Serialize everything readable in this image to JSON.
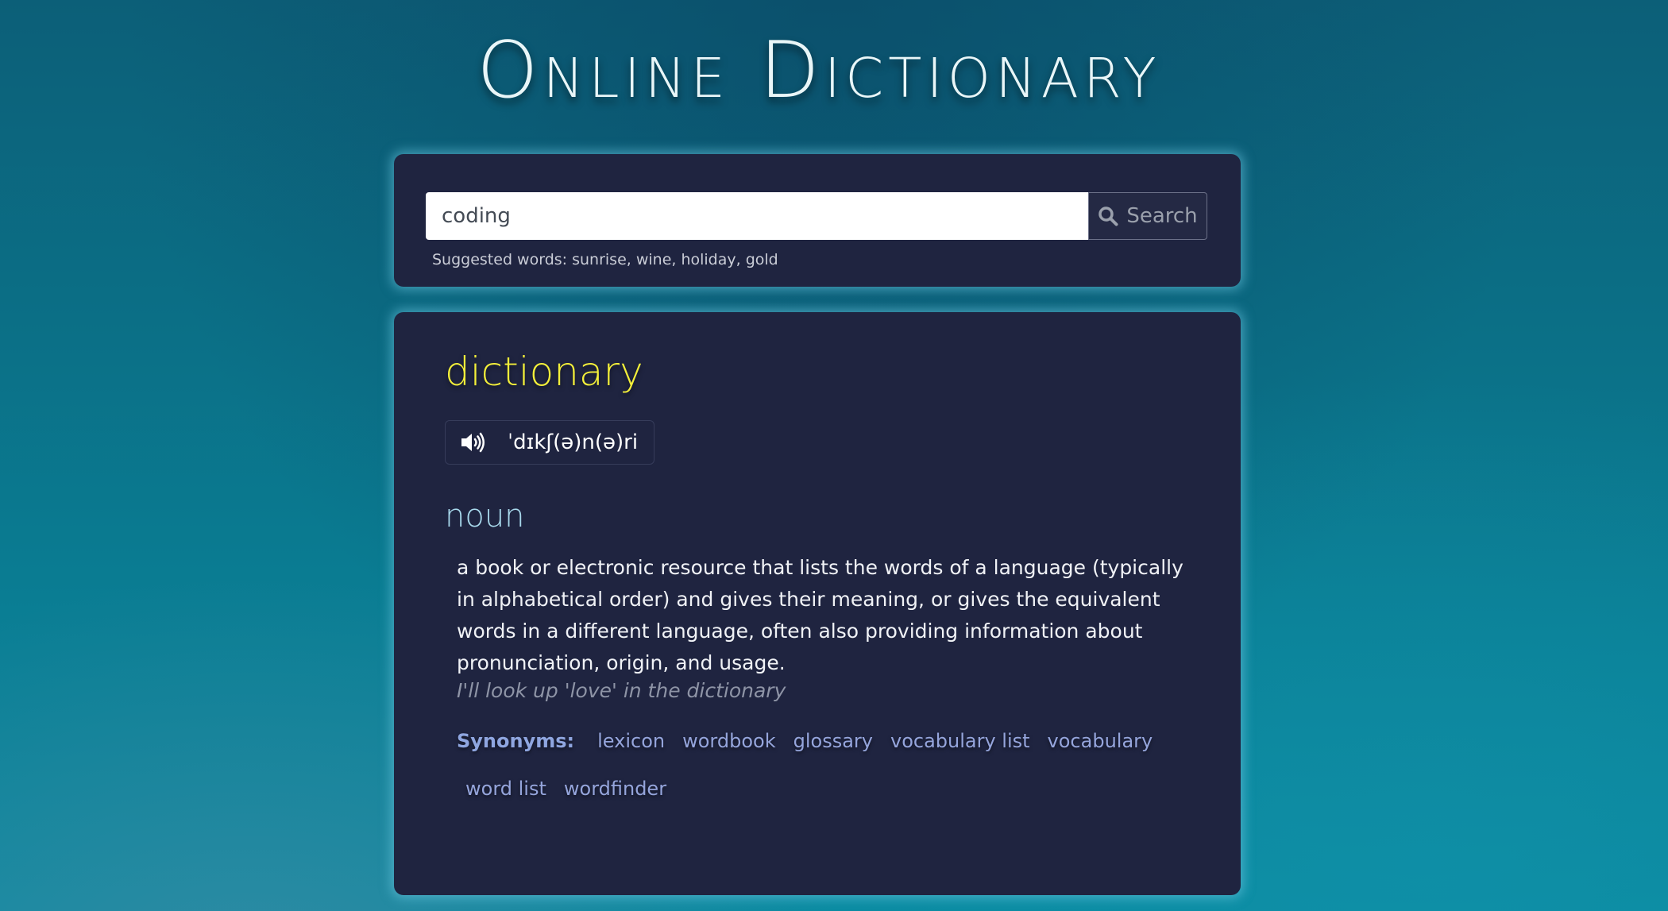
{
  "header": {
    "title": "Online Dictionary"
  },
  "search": {
    "value": "coding",
    "placeholder": "",
    "button_label": "Search",
    "suggestions": "Suggested words: sunrise, wine, holiday, gold"
  },
  "result": {
    "word": "dictionary",
    "phonetic": "ˈdɪkʃ(ə)n(ə)ri",
    "part_of_speech": "noun",
    "definition": "a book or electronic resource that lists the words of a language (typically in alphabetical order) and gives their meaning, or gives the equivalent words in a different language, often also providing information about pronunciation, origin, and usage.",
    "example": "I'll look up 'love' in the dictionary",
    "synonyms_label": "Synonyms:",
    "synonyms": [
      "lexicon",
      "wordbook",
      "glossary",
      "vocabulary list",
      "vocabulary",
      "word list",
      "wordfinder"
    ]
  },
  "icons": {
    "search": "search-icon",
    "audio": "speaker-icon"
  },
  "colors": {
    "background": "#0b6f86",
    "panel": "#1f2440",
    "word": "#f3ef3a",
    "part_of_speech": "#a8d9ec",
    "synonym": "#95a5dc"
  }
}
